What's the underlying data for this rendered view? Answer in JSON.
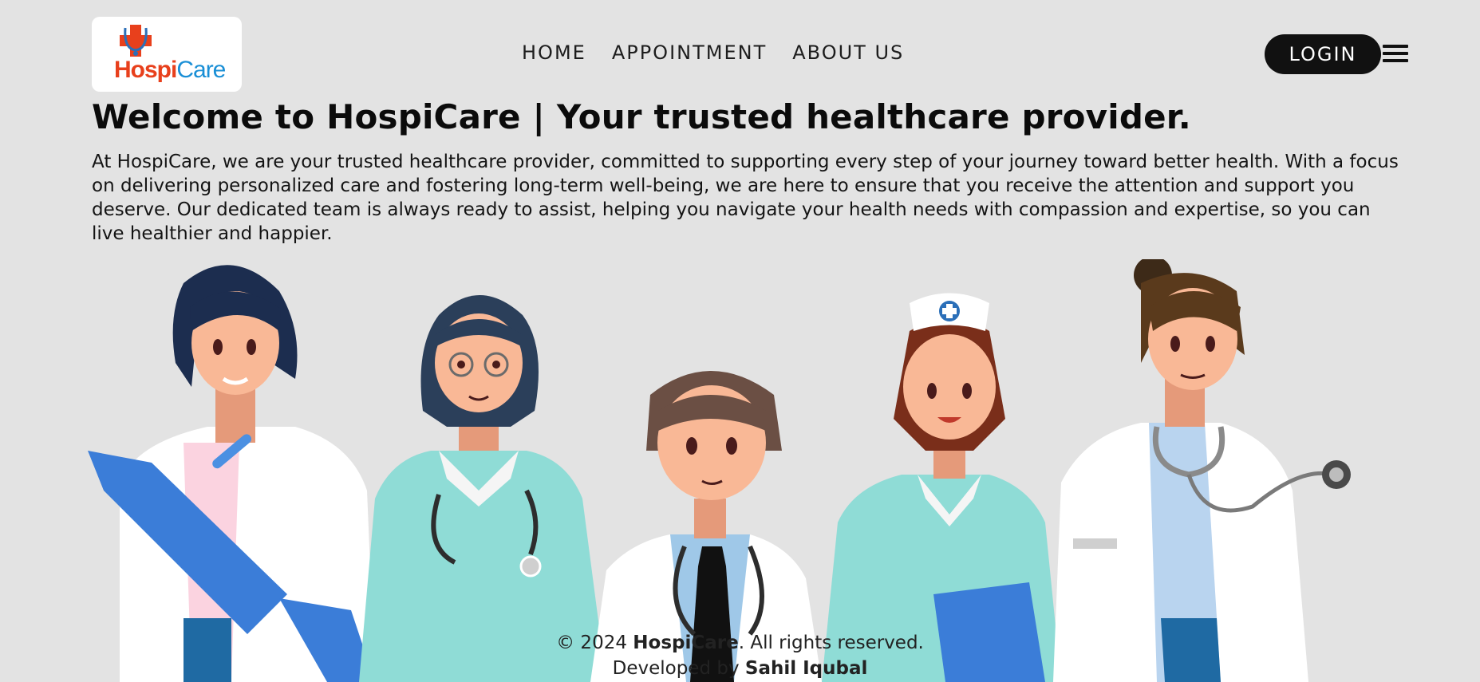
{
  "brand": {
    "name_part1": "Hospi",
    "name_part2": "Care"
  },
  "nav": {
    "items": [
      {
        "label": "HOME"
      },
      {
        "label": "APPOINTMENT"
      },
      {
        "label": "ABOUT US"
      }
    ],
    "login_label": "LOGIN"
  },
  "hero": {
    "title": "Welcome to HospiCare | Your trusted healthcare provider.",
    "description": "At HospiCare, we are your trusted healthcare provider, committed to supporting every step of your journey toward better health. With a focus on delivering personalized care and fostering long-term well-being, we are here to ensure that you receive the attention and support you deserve. Our dedicated team is always ready to assist, helping you navigate your health needs with compassion and expertise, so you can live healthier and happier."
  },
  "footer": {
    "copyright_prefix": "© 2024 ",
    "copyright_brand": "HospiCare",
    "copyright_suffix": ". All rights reserved.",
    "developed_prefix": "Developed by ",
    "developer_name": "Sahil Iqubal"
  },
  "colors": {
    "background": "#e3e3e3",
    "brand_red": "#e8401c",
    "brand_blue": "#1a8fd6",
    "login_bg": "#111111"
  },
  "icons": {
    "logo": "medical-cross-stethoscope-icon",
    "menu": "hamburger-menu-icon"
  }
}
